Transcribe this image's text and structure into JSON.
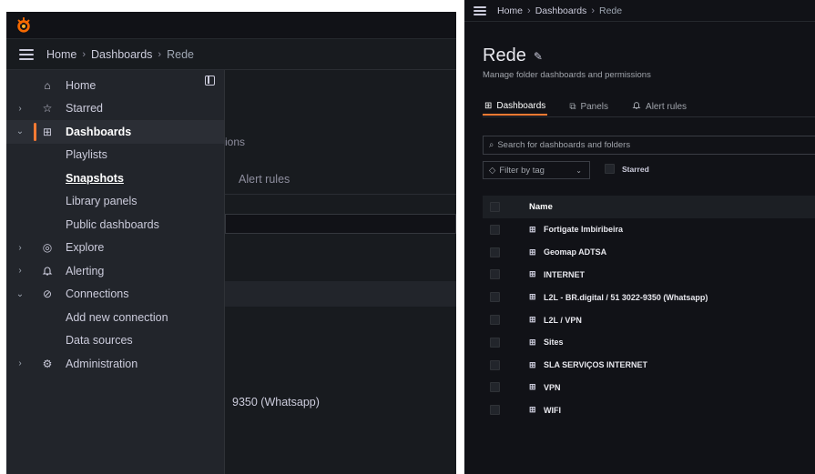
{
  "left": {
    "breadcrumb": [
      "Home",
      "Dashboards",
      "Rede"
    ],
    "menu": [
      {
        "label": "Home",
        "chevron": "",
        "icon": "⌂",
        "name": "home"
      },
      {
        "label": "Starred",
        "chevron": "›",
        "icon": "☆",
        "name": "starred"
      },
      {
        "label": "Dashboards",
        "chevron": "⌄",
        "icon": "⊞",
        "name": "dashboards"
      },
      {
        "label": "Playlists",
        "name": "playlists"
      },
      {
        "label": "Snapshots",
        "name": "snapshots"
      },
      {
        "label": "Library panels",
        "name": "library-panels"
      },
      {
        "label": "Public dashboards",
        "name": "public-dashboards"
      },
      {
        "label": "Explore",
        "chevron": "›",
        "icon": "◎",
        "name": "explore"
      },
      {
        "label": "Alerting",
        "chevron": "›",
        "icon": "♫",
        "name": "alerting"
      },
      {
        "label": "Connections",
        "chevron": "⌄",
        "icon": "⊘",
        "name": "connections"
      },
      {
        "label": "Add new connection",
        "name": "add-new-connection"
      },
      {
        "label": "Data sources",
        "name": "data-sources"
      },
      {
        "label": "Administration",
        "chevron": "›",
        "icon": "⚙",
        "name": "administration"
      }
    ],
    "background": {
      "ions": "ions",
      "alert_rules": "Alert rules",
      "whatsapp": "9350 (Whatsapp)"
    }
  },
  "right": {
    "breadcrumb": [
      "Home",
      "Dashboards",
      "Rede"
    ],
    "title": "Rede",
    "subtitle": "Manage folder dashboards and permissions",
    "tabs": [
      "Dashboards",
      "Panels",
      "Alert rules"
    ],
    "search_placeholder": "Search for dashboards and folders",
    "filter_label": "Filter by tag",
    "starred_label": "Starred",
    "table_header": "Name",
    "rows": [
      "Fortigate Imbiribeira",
      "Geomap ADTSA",
      "INTERNET",
      "L2L - BR.digital / 51 3022-9350 (Whatsapp)",
      "L2L / VPN",
      "Sites",
      "SLA SERVIÇOS INTERNET",
      "VPN",
      "WIFI"
    ]
  },
  "colors": {
    "accent": "#ff7a33",
    "bg_dark": "#111217",
    "menu_bg": "#22252b"
  }
}
